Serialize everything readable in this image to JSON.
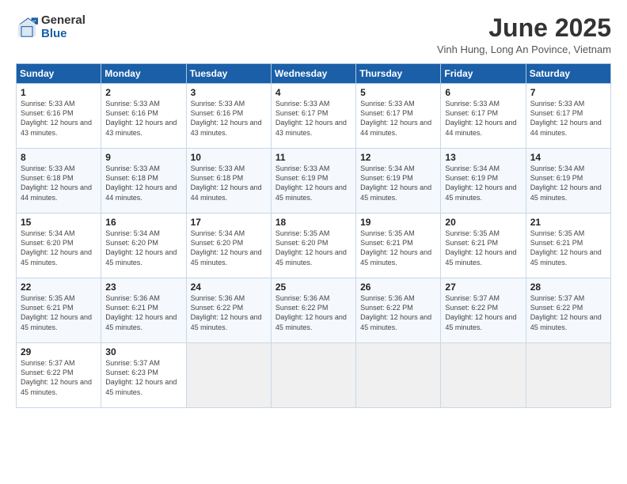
{
  "logo": {
    "general": "General",
    "blue": "Blue"
  },
  "title": "June 2025",
  "location": "Vinh Hung, Long An Povince, Vietnam",
  "weekdays": [
    "Sunday",
    "Monday",
    "Tuesday",
    "Wednesday",
    "Thursday",
    "Friday",
    "Saturday"
  ],
  "weeks": [
    [
      {
        "day": "1",
        "rise": "5:33 AM",
        "set": "6:16 PM",
        "daylight": "12 hours and 43 minutes."
      },
      {
        "day": "2",
        "rise": "5:33 AM",
        "set": "6:16 PM",
        "daylight": "12 hours and 43 minutes."
      },
      {
        "day": "3",
        "rise": "5:33 AM",
        "set": "6:16 PM",
        "daylight": "12 hours and 43 minutes."
      },
      {
        "day": "4",
        "rise": "5:33 AM",
        "set": "6:17 PM",
        "daylight": "12 hours and 43 minutes."
      },
      {
        "day": "5",
        "rise": "5:33 AM",
        "set": "6:17 PM",
        "daylight": "12 hours and 44 minutes."
      },
      {
        "day": "6",
        "rise": "5:33 AM",
        "set": "6:17 PM",
        "daylight": "12 hours and 44 minutes."
      },
      {
        "day": "7",
        "rise": "5:33 AM",
        "set": "6:17 PM",
        "daylight": "12 hours and 44 minutes."
      }
    ],
    [
      {
        "day": "8",
        "rise": "5:33 AM",
        "set": "6:18 PM",
        "daylight": "12 hours and 44 minutes."
      },
      {
        "day": "9",
        "rise": "5:33 AM",
        "set": "6:18 PM",
        "daylight": "12 hours and 44 minutes."
      },
      {
        "day": "10",
        "rise": "5:33 AM",
        "set": "6:18 PM",
        "daylight": "12 hours and 44 minutes."
      },
      {
        "day": "11",
        "rise": "5:33 AM",
        "set": "6:19 PM",
        "daylight": "12 hours and 45 minutes."
      },
      {
        "day": "12",
        "rise": "5:34 AM",
        "set": "6:19 PM",
        "daylight": "12 hours and 45 minutes."
      },
      {
        "day": "13",
        "rise": "5:34 AM",
        "set": "6:19 PM",
        "daylight": "12 hours and 45 minutes."
      },
      {
        "day": "14",
        "rise": "5:34 AM",
        "set": "6:19 PM",
        "daylight": "12 hours and 45 minutes."
      }
    ],
    [
      {
        "day": "15",
        "rise": "5:34 AM",
        "set": "6:20 PM",
        "daylight": "12 hours and 45 minutes."
      },
      {
        "day": "16",
        "rise": "5:34 AM",
        "set": "6:20 PM",
        "daylight": "12 hours and 45 minutes."
      },
      {
        "day": "17",
        "rise": "5:34 AM",
        "set": "6:20 PM",
        "daylight": "12 hours and 45 minutes."
      },
      {
        "day": "18",
        "rise": "5:35 AM",
        "set": "6:20 PM",
        "daylight": "12 hours and 45 minutes."
      },
      {
        "day": "19",
        "rise": "5:35 AM",
        "set": "6:21 PM",
        "daylight": "12 hours and 45 minutes."
      },
      {
        "day": "20",
        "rise": "5:35 AM",
        "set": "6:21 PM",
        "daylight": "12 hours and 45 minutes."
      },
      {
        "day": "21",
        "rise": "5:35 AM",
        "set": "6:21 PM",
        "daylight": "12 hours and 45 minutes."
      }
    ],
    [
      {
        "day": "22",
        "rise": "5:35 AM",
        "set": "6:21 PM",
        "daylight": "12 hours and 45 minutes."
      },
      {
        "day": "23",
        "rise": "5:36 AM",
        "set": "6:21 PM",
        "daylight": "12 hours and 45 minutes."
      },
      {
        "day": "24",
        "rise": "5:36 AM",
        "set": "6:22 PM",
        "daylight": "12 hours and 45 minutes."
      },
      {
        "day": "25",
        "rise": "5:36 AM",
        "set": "6:22 PM",
        "daylight": "12 hours and 45 minutes."
      },
      {
        "day": "26",
        "rise": "5:36 AM",
        "set": "6:22 PM",
        "daylight": "12 hours and 45 minutes."
      },
      {
        "day": "27",
        "rise": "5:37 AM",
        "set": "6:22 PM",
        "daylight": "12 hours and 45 minutes."
      },
      {
        "day": "28",
        "rise": "5:37 AM",
        "set": "6:22 PM",
        "daylight": "12 hours and 45 minutes."
      }
    ],
    [
      {
        "day": "29",
        "rise": "5:37 AM",
        "set": "6:22 PM",
        "daylight": "12 hours and 45 minutes."
      },
      {
        "day": "30",
        "rise": "5:37 AM",
        "set": "6:23 PM",
        "daylight": "12 hours and 45 minutes."
      },
      null,
      null,
      null,
      null,
      null
    ]
  ]
}
